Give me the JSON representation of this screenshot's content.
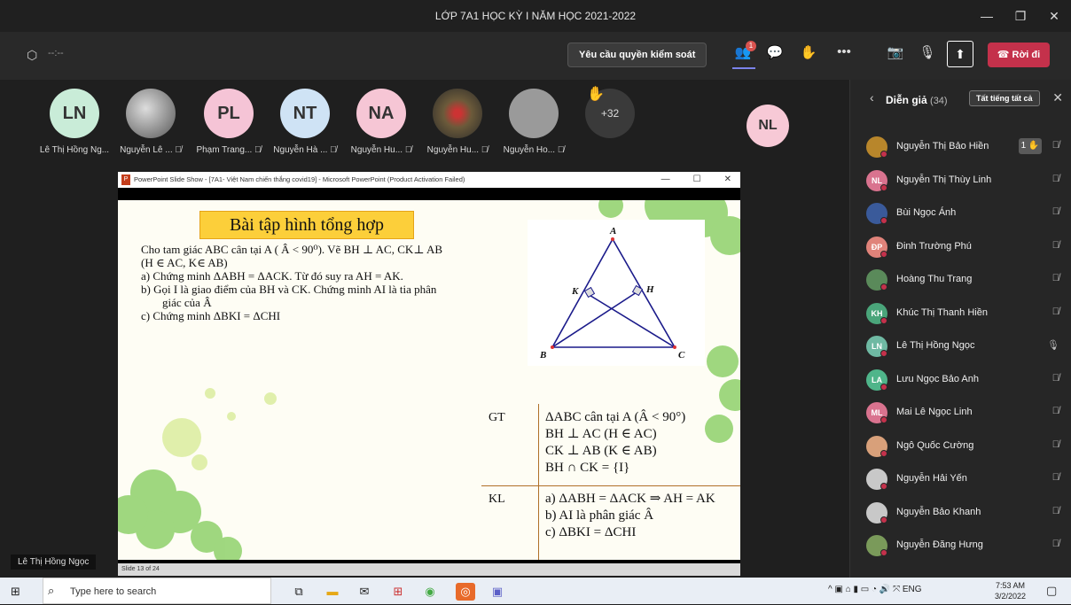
{
  "window": {
    "title": "LỚP 7A1 HỌC KỲ I NĂM HỌC 2021-2022",
    "min": "—",
    "max": "❐",
    "close": "✕"
  },
  "toolbar": {
    "timer": "--:--",
    "request_control": "Yêu cầu quyền kiểm soát",
    "people_badge": "1",
    "leave": "Rời đi",
    "more": "•••"
  },
  "participants": [
    {
      "initials": "LN",
      "name": "Lê Thị Hồng Ng...",
      "color": "#c9ecd8",
      "muted": false
    },
    {
      "initials": "",
      "name": "Nguyễn Lê ...",
      "color": "#888",
      "muted": true
    },
    {
      "initials": "PL",
      "name": "Phạm Trang...",
      "color": "#f5c4d6",
      "muted": true
    },
    {
      "initials": "NT",
      "name": "Nguyễn Hà ...",
      "color": "#cfe3f5",
      "muted": true
    },
    {
      "initials": "NA",
      "name": "Nguyễn Hu...",
      "color": "#f6c6d5",
      "muted": true
    },
    {
      "initials": "",
      "name": "Nguyễn Hu...",
      "color": "#6b5a3a",
      "muted": true
    },
    {
      "initials": "",
      "name": "Nguyễn Ho...",
      "color": "#9a9a9a",
      "muted": true
    }
  ],
  "overflow_count": "+32",
  "presenter_tile": {
    "initials": "NL",
    "color": "#f7c9d6"
  },
  "presenter_name": "Lê Thị Hồng Ngọc",
  "ppt": {
    "title": "PowerPoint Slide Show - [7A1- Việt Nam chiến thắng covid19] - Microsoft PowerPoint (Product Activation Failed)",
    "status": "Slide 13 of 24"
  },
  "slide": {
    "title": "Bài tập hình tổng hợp",
    "lines": [
      "Cho tam giác ABC cân tại A ( Â < 90⁰). Vẽ BH ⊥ AC, CK⊥ AB",
      "(H ∈ AC, K∈ AB)",
      "a)  Chứng minh ΔABH = ΔACK. Từ đó suy ra AH = AK.",
      "b)  Gọi I là giao điểm của BH và CK. Chứng minh AI là tia phân",
      "giác của Â",
      "c)  Chứng minh ΔBKI = ΔCHI"
    ],
    "gt_label": "GT",
    "gt": [
      "ΔABC cân tại A (Â < 90°)",
      "BH ⊥ AC (H ∈ AC)",
      "CK ⊥ AB (K ∈ AB)",
      "BH ∩ CK = {I}"
    ],
    "kl_label": "KL",
    "kl": [
      "a)   ΔABH = ΔACK ⇒ AH = AK",
      "b)   AI là phân giác Â",
      "c)   ΔBKI = ΔCHI"
    ],
    "pts": {
      "A": "A",
      "B": "B",
      "C": "C",
      "H": "H",
      "K": "K"
    }
  },
  "side": {
    "title": "Diễn giả",
    "count": "(34)",
    "mute_all": "Tất tiếng tất cả",
    "people": [
      {
        "ini": "",
        "name": "Nguyễn Thị Bảo Hiền",
        "color": "#b8862b",
        "hand": "1 ✋",
        "mic": "🎙̸"
      },
      {
        "ini": "NL",
        "name": "Nguyễn Thị Thùy Linh",
        "color": "#d9738f",
        "hand": "",
        "mic": "🎙̸"
      },
      {
        "ini": "",
        "name": "Bùi Ngọc Ánh",
        "color": "#3a5a9a",
        "hand": "",
        "mic": "🎙̸"
      },
      {
        "ini": "ĐP",
        "name": "Đinh Trường Phú",
        "color": "#e0837a",
        "hand": "",
        "mic": "🎙̸"
      },
      {
        "ini": "",
        "name": "Hoàng Thu Trang",
        "color": "#5a8a5a",
        "hand": "",
        "mic": "🎙̸"
      },
      {
        "ini": "KH",
        "name": "Khúc Thị Thanh Hiền",
        "color": "#4aa57a",
        "hand": "",
        "mic": "🎙̸"
      },
      {
        "ini": "LN",
        "name": "Lê Thị Hồng Ngọc",
        "color": "#6fb9a3",
        "hand": "",
        "mic": "🎙"
      },
      {
        "ini": "LA",
        "name": "Lưu Ngọc Bảo Anh",
        "color": "#4fb58a",
        "hand": "",
        "mic": "🎙̸"
      },
      {
        "ini": "ML",
        "name": "Mai Lê Ngọc Linh",
        "color": "#d9738f",
        "hand": "",
        "mic": "🎙̸"
      },
      {
        "ini": "",
        "name": "Ngô Quốc Cường",
        "color": "#d8a07a",
        "hand": "",
        "mic": "🎙̸"
      },
      {
        "ini": "",
        "name": "Nguyễn Hải Yến",
        "color": "#c8c8c8",
        "hand": "",
        "mic": "🎙̸"
      },
      {
        "ini": "",
        "name": "Nguyễn Bảo Khanh",
        "color": "#c8c8c8",
        "hand": "",
        "mic": "🎙̸"
      },
      {
        "ini": "",
        "name": "Nguyễn Đăng Hưng",
        "color": "#7a9a5a",
        "hand": "",
        "mic": "🎙̸"
      }
    ]
  },
  "taskbar": {
    "search": "Type here to search",
    "lang": "ENG",
    "time": "7:53 AM",
    "date": "3/2/2022"
  }
}
